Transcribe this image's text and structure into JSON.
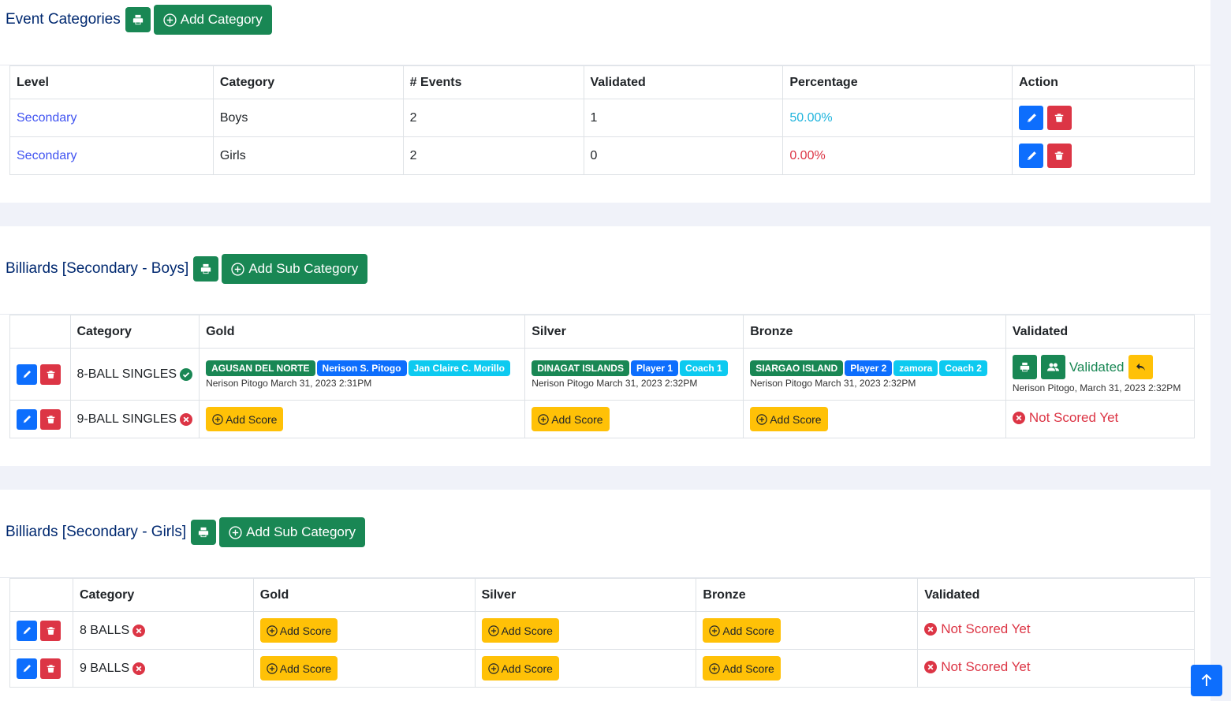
{
  "categories_card": {
    "title": "Event Categories",
    "add_button": "Add Category",
    "headers": [
      "Level",
      "Category",
      "# Events",
      "Validated",
      "Percentage",
      "Action"
    ],
    "rows": [
      {
        "level": "Secondary",
        "category": "Boys",
        "events": "2",
        "validated": "1",
        "percentage": "50.00%"
      },
      {
        "level": "Secondary",
        "category": "Girls",
        "events": "2",
        "validated": "0",
        "percentage": "0.00%"
      }
    ]
  },
  "boys_card": {
    "title": "Billiards [Secondary - Boys]",
    "add_button": "Add Sub Category",
    "headers": [
      "",
      "Category",
      "Gold",
      "Silver",
      "Bronze",
      "Validated"
    ],
    "rows": [
      {
        "category": "8-BALL SINGLES",
        "gold": {
          "badges": [
            "AGUSAN DEL NORTE",
            "Nerison S. Pitogo",
            "Jan Claire C. Morillo"
          ],
          "meta": "Nerison Pitogo March 31, 2023 2:31PM"
        },
        "silver": {
          "badges": [
            "DINAGAT ISLANDS",
            "Player 1",
            "Coach 1"
          ],
          "meta": "Nerison Pitogo March 31, 2023 2:32PM"
        },
        "bronze": {
          "badges": [
            "SIARGAO ISLAND",
            "Player 2",
            "zamora",
            "Coach 2"
          ],
          "meta": "Nerison Pitogo March 31, 2023 2:32PM"
        },
        "validated_label": "Validated",
        "validated_meta": "Nerison Pitogo, March 31, 2023 2:32PM"
      },
      {
        "category": "9-BALL SINGLES",
        "gold_add": "Add Score",
        "silver_add": "Add Score",
        "bronze_add": "Add Score",
        "status": "Not Scored Yet"
      }
    ]
  },
  "girls_card": {
    "title": "Billiards [Secondary - Girls]",
    "add_button": "Add Sub Category",
    "headers": [
      "",
      "Category",
      "Gold",
      "Silver",
      "Bronze",
      "Validated"
    ],
    "rows": [
      {
        "category": "8 BALLS",
        "gold_add": "Add Score",
        "silver_add": "Add Score",
        "bronze_add": "Add Score",
        "status": "Not Scored Yet"
      },
      {
        "category": "9 BALLS",
        "gold_add": "Add Score",
        "silver_add": "Add Score",
        "bronze_add": "Add Score",
        "status": "Not Scored Yet"
      }
    ]
  },
  "icons": [
    "printer-icon",
    "plus-circle-icon",
    "pencil-icon",
    "trash-icon",
    "check-circle-icon",
    "x-circle-icon",
    "users-icon",
    "undo-icon",
    "arrow-up-icon"
  ],
  "colors": {
    "primary": "#0d6efd",
    "success": "#198754",
    "danger": "#dc3545",
    "warning": "#ffc107",
    "info": "#0dcaf0",
    "title": "#012970"
  }
}
